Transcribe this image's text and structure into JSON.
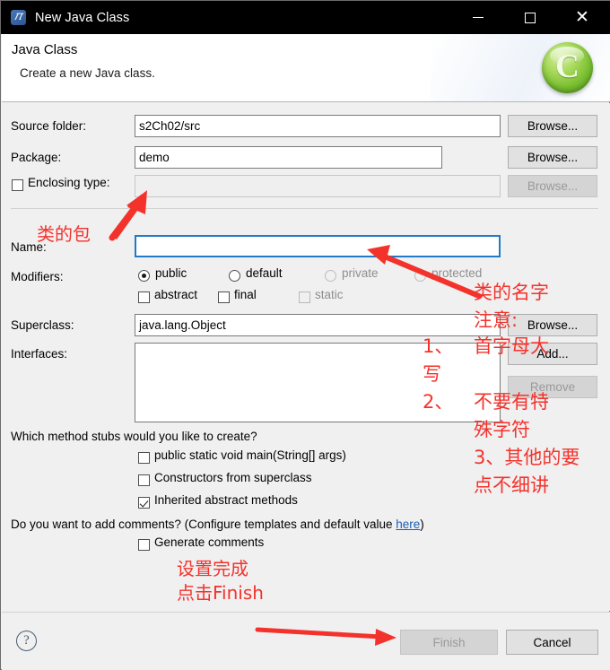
{
  "window": {
    "title": "New Java Class",
    "app_icon": "java-class-icon",
    "controls": {
      "minimize": "minimize-icon",
      "maximize": "maximize-icon",
      "close": "close-icon"
    }
  },
  "header": {
    "title": "Java Class",
    "subtitle": "Create a new Java class.",
    "logo_letter": "C"
  },
  "form": {
    "source_folder": {
      "label": "Source folder:",
      "value": "s2Ch02/src",
      "browse": "Browse..."
    },
    "package": {
      "label": "Package:",
      "value": "demo",
      "browse": "Browse..."
    },
    "enclosing_type": {
      "label": "Enclosing type:",
      "value": "",
      "browse": "Browse...",
      "checked": false
    },
    "name": {
      "label": "Name:",
      "value": ""
    },
    "modifiers": {
      "label": "Modifiers:",
      "radios": [
        {
          "label": "public",
          "selected": true,
          "enabled": true
        },
        {
          "label": "default",
          "selected": false,
          "enabled": true
        },
        {
          "label": "private",
          "selected": false,
          "enabled": false
        },
        {
          "label": "protected",
          "selected": false,
          "enabled": false
        }
      ],
      "checkboxes": [
        {
          "label": "abstract",
          "checked": false,
          "enabled": true
        },
        {
          "label": "final",
          "checked": false,
          "enabled": true
        },
        {
          "label": "static",
          "checked": false,
          "enabled": false
        }
      ]
    },
    "superclass": {
      "label": "Superclass:",
      "value": "java.lang.Object",
      "browse": "Browse..."
    },
    "interfaces": {
      "label": "Interfaces:",
      "items": [],
      "add": "Add...",
      "remove": "Remove"
    }
  },
  "stubs": {
    "question": "Which method stubs would you like to create?",
    "options": [
      {
        "label": "public static void main(String[] args)",
        "checked": false
      },
      {
        "label": "Constructors from superclass",
        "checked": false
      },
      {
        "label": "Inherited abstract methods",
        "checked": true
      }
    ]
  },
  "comments": {
    "question_prefix": "Do you want to add comments? (Configure templates and default value ",
    "link": "here",
    "question_suffix": ")",
    "option": {
      "label": "Generate comments",
      "checked": false
    }
  },
  "footer": {
    "help": "?",
    "finish": "Finish",
    "finish_enabled": false,
    "cancel": "Cancel",
    "cancel_enabled": true
  },
  "annotations": {
    "package_note": "类的包",
    "name_note": "类的名字",
    "attention": "注意:",
    "point1": "1、",
    "point1b": "首字母大",
    "point1c": "写",
    "point2": "2、",
    "point2b": "不要有特",
    "point2c": "殊字符",
    "point3": "3、其他的要",
    "point3b": "点不细讲",
    "finish_note_line1": "设置完成",
    "finish_note_line2": "点击Finish",
    "color": "#f4322c"
  }
}
